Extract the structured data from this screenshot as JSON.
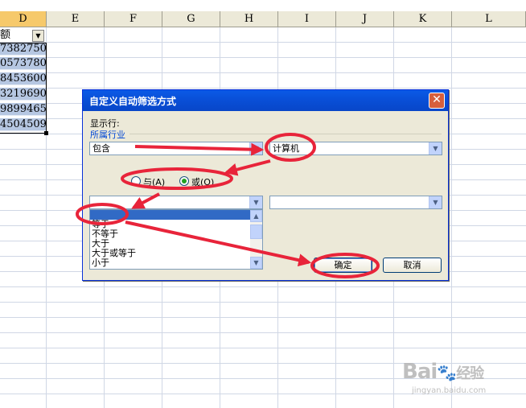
{
  "spreadsheet": {
    "columns": [
      "D",
      "E",
      "F",
      "G",
      "H",
      "I",
      "J",
      "K",
      "L"
    ],
    "header_cell": "额",
    "values": [
      "7382750",
      "0573780",
      "8453600",
      "3219690",
      "9899465",
      "4504509"
    ]
  },
  "dialog": {
    "title": "自定义自动筛选方式",
    "show_rows_label": "显示行:",
    "field_label": "所属行业",
    "condition1": {
      "operator": "包含",
      "value": "计算机"
    },
    "logic": {
      "and_label": "与(A)",
      "or_label": "或(O)",
      "selected": "or"
    },
    "condition2": {
      "operator": "",
      "value": ""
    },
    "operator_list": [
      "等于",
      "不等于",
      "大于",
      "大于或等于",
      "小于"
    ],
    "ok_label": "确定",
    "cancel_label": "取消"
  },
  "colors": {
    "selection_fill": "#b6c7e2",
    "title_bar": "#0a5ae6",
    "annotation_red": "#e8243a"
  },
  "watermark": {
    "brand": "Bai",
    "brand_cn": "经验",
    "url": "jingyan.baidu.com"
  }
}
